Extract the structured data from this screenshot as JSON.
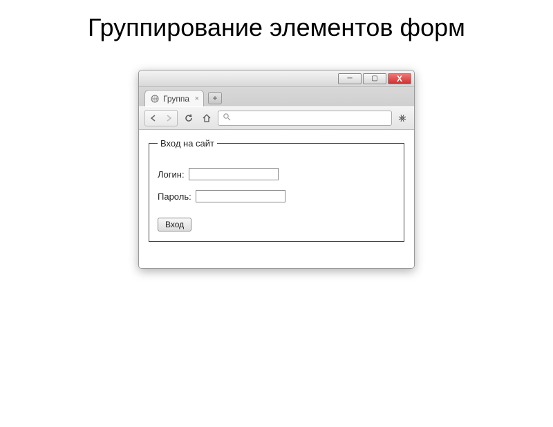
{
  "slide": {
    "title": "Группирование элементов форм"
  },
  "browser": {
    "tab_title": "Группа",
    "window_buttons": {
      "minimize": "─",
      "maximize": "▢",
      "close": "X"
    },
    "new_tab": "+",
    "tab_close": "×",
    "url_placeholder": ""
  },
  "form": {
    "legend": "Вход на сайт",
    "login_label": "Логин:",
    "login_value": "",
    "password_label": "Пароль:",
    "password_value": "",
    "submit_label": "Вход"
  }
}
